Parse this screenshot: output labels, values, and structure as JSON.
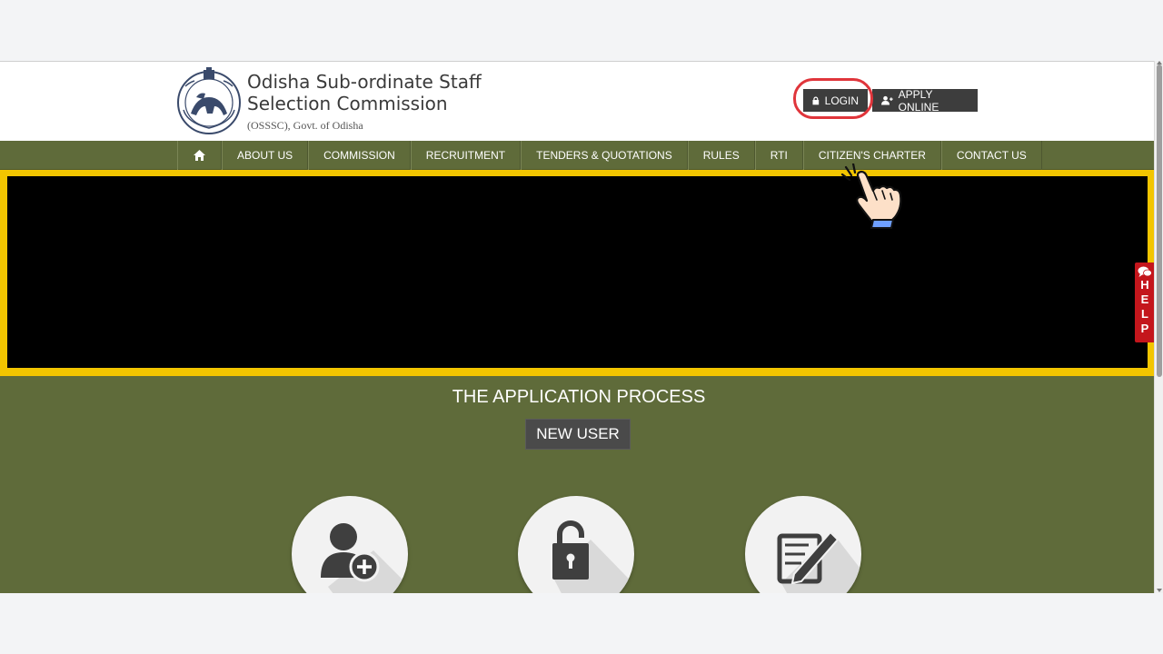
{
  "header": {
    "org_name_line1": "Odisha Sub-ordinate Staff",
    "org_name_line2": "Selection Commission",
    "org_sub": "(OSSSC), Govt. of Odisha",
    "login_label": "LOGIN",
    "apply_label": "APPLY ONLINE"
  },
  "nav": {
    "home_icon": "home-icon",
    "items": [
      {
        "label": "ABOUT US"
      },
      {
        "label": "COMMISSION"
      },
      {
        "label": "RECRUITMENT"
      },
      {
        "label": "TENDERS & QUOTATIONS"
      },
      {
        "label": "RULES"
      },
      {
        "label": "RTI"
      },
      {
        "label": "CITIZEN'S CHARTER"
      },
      {
        "label": "CONTACT US"
      }
    ]
  },
  "process": {
    "title": "THE APPLICATION PROCESS",
    "new_user_label": "NEW USER",
    "steps": [
      {
        "icon": "add-user-icon"
      },
      {
        "icon": "padlock-icon"
      },
      {
        "icon": "edit-form-icon"
      }
    ]
  },
  "help": {
    "letters": "H\nE\nL\nP",
    "icon": "chat-icon"
  },
  "colors": {
    "nav_green": "#5f6b3a",
    "banner_border": "#f2c500",
    "help_red": "#c4161c",
    "button_dark": "#3d3d3d",
    "highlight_ring": "#e0353b"
  }
}
